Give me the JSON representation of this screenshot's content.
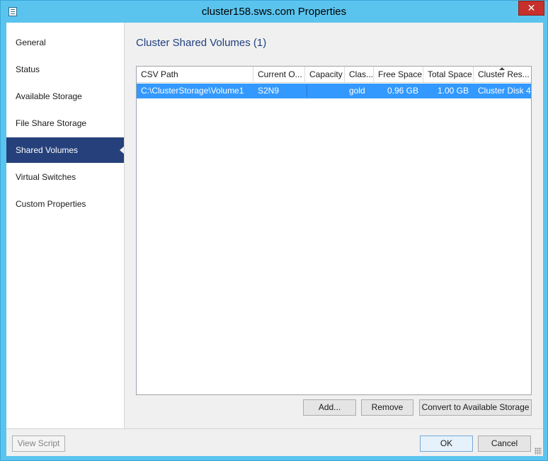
{
  "window": {
    "title": "cluster158.sws.com Properties",
    "close_glyph": "✕"
  },
  "sidebar": {
    "items": [
      {
        "label": "General"
      },
      {
        "label": "Status"
      },
      {
        "label": "Available Storage"
      },
      {
        "label": "File Share Storage"
      },
      {
        "label": "Shared Volumes",
        "selected": true
      },
      {
        "label": "Virtual Switches"
      },
      {
        "label": "Custom Properties"
      }
    ]
  },
  "main": {
    "title": "Cluster Shared Volumes (1)",
    "grid": {
      "columns": [
        "CSV Path",
        "Current O...",
        "Capacity",
        "Clas...",
        "Free Space",
        "Total Space",
        "Cluster Res..."
      ],
      "sorted_column": "Cluster Res...",
      "rows": [
        [
          "C:\\ClusterStorage\\Volume1",
          "S2N9",
          "",
          "gold",
          "0.96 GB",
          "1.00 GB",
          "Cluster Disk 4"
        ]
      ]
    },
    "buttons": {
      "add": "Add...",
      "remove": "Remove",
      "convert": "Convert to Available Storage"
    }
  },
  "footer": {
    "view_script": "View Script",
    "ok": "OK",
    "cancel": "Cancel"
  },
  "colors": {
    "accent": "#25407a",
    "selection": "#3399ff",
    "title_bar": "#5bc4ee",
    "close": "#c7302b"
  }
}
